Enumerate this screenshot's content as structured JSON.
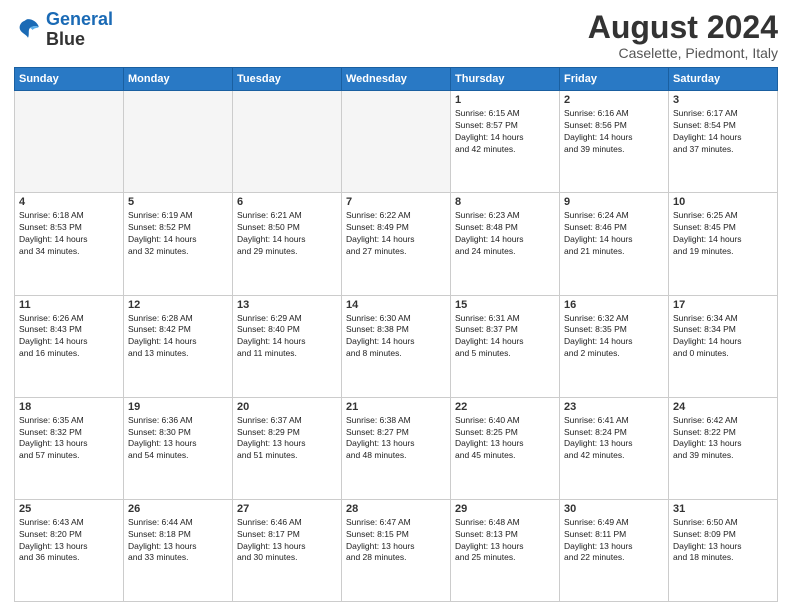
{
  "header": {
    "logo_line1": "General",
    "logo_line2": "Blue",
    "month_year": "August 2024",
    "location": "Caselette, Piedmont, Italy"
  },
  "weekdays": [
    "Sunday",
    "Monday",
    "Tuesday",
    "Wednesday",
    "Thursday",
    "Friday",
    "Saturday"
  ],
  "weeks": [
    [
      {
        "day": "",
        "info": ""
      },
      {
        "day": "",
        "info": ""
      },
      {
        "day": "",
        "info": ""
      },
      {
        "day": "",
        "info": ""
      },
      {
        "day": "1",
        "info": "Sunrise: 6:15 AM\nSunset: 8:57 PM\nDaylight: 14 hours\nand 42 minutes."
      },
      {
        "day": "2",
        "info": "Sunrise: 6:16 AM\nSunset: 8:56 PM\nDaylight: 14 hours\nand 39 minutes."
      },
      {
        "day": "3",
        "info": "Sunrise: 6:17 AM\nSunset: 8:54 PM\nDaylight: 14 hours\nand 37 minutes."
      }
    ],
    [
      {
        "day": "4",
        "info": "Sunrise: 6:18 AM\nSunset: 8:53 PM\nDaylight: 14 hours\nand 34 minutes."
      },
      {
        "day": "5",
        "info": "Sunrise: 6:19 AM\nSunset: 8:52 PM\nDaylight: 14 hours\nand 32 minutes."
      },
      {
        "day": "6",
        "info": "Sunrise: 6:21 AM\nSunset: 8:50 PM\nDaylight: 14 hours\nand 29 minutes."
      },
      {
        "day": "7",
        "info": "Sunrise: 6:22 AM\nSunset: 8:49 PM\nDaylight: 14 hours\nand 27 minutes."
      },
      {
        "day": "8",
        "info": "Sunrise: 6:23 AM\nSunset: 8:48 PM\nDaylight: 14 hours\nand 24 minutes."
      },
      {
        "day": "9",
        "info": "Sunrise: 6:24 AM\nSunset: 8:46 PM\nDaylight: 14 hours\nand 21 minutes."
      },
      {
        "day": "10",
        "info": "Sunrise: 6:25 AM\nSunset: 8:45 PM\nDaylight: 14 hours\nand 19 minutes."
      }
    ],
    [
      {
        "day": "11",
        "info": "Sunrise: 6:26 AM\nSunset: 8:43 PM\nDaylight: 14 hours\nand 16 minutes."
      },
      {
        "day": "12",
        "info": "Sunrise: 6:28 AM\nSunset: 8:42 PM\nDaylight: 14 hours\nand 13 minutes."
      },
      {
        "day": "13",
        "info": "Sunrise: 6:29 AM\nSunset: 8:40 PM\nDaylight: 14 hours\nand 11 minutes."
      },
      {
        "day": "14",
        "info": "Sunrise: 6:30 AM\nSunset: 8:38 PM\nDaylight: 14 hours\nand 8 minutes."
      },
      {
        "day": "15",
        "info": "Sunrise: 6:31 AM\nSunset: 8:37 PM\nDaylight: 14 hours\nand 5 minutes."
      },
      {
        "day": "16",
        "info": "Sunrise: 6:32 AM\nSunset: 8:35 PM\nDaylight: 14 hours\nand 2 minutes."
      },
      {
        "day": "17",
        "info": "Sunrise: 6:34 AM\nSunset: 8:34 PM\nDaylight: 14 hours\nand 0 minutes."
      }
    ],
    [
      {
        "day": "18",
        "info": "Sunrise: 6:35 AM\nSunset: 8:32 PM\nDaylight: 13 hours\nand 57 minutes."
      },
      {
        "day": "19",
        "info": "Sunrise: 6:36 AM\nSunset: 8:30 PM\nDaylight: 13 hours\nand 54 minutes."
      },
      {
        "day": "20",
        "info": "Sunrise: 6:37 AM\nSunset: 8:29 PM\nDaylight: 13 hours\nand 51 minutes."
      },
      {
        "day": "21",
        "info": "Sunrise: 6:38 AM\nSunset: 8:27 PM\nDaylight: 13 hours\nand 48 minutes."
      },
      {
        "day": "22",
        "info": "Sunrise: 6:40 AM\nSunset: 8:25 PM\nDaylight: 13 hours\nand 45 minutes."
      },
      {
        "day": "23",
        "info": "Sunrise: 6:41 AM\nSunset: 8:24 PM\nDaylight: 13 hours\nand 42 minutes."
      },
      {
        "day": "24",
        "info": "Sunrise: 6:42 AM\nSunset: 8:22 PM\nDaylight: 13 hours\nand 39 minutes."
      }
    ],
    [
      {
        "day": "25",
        "info": "Sunrise: 6:43 AM\nSunset: 8:20 PM\nDaylight: 13 hours\nand 36 minutes."
      },
      {
        "day": "26",
        "info": "Sunrise: 6:44 AM\nSunset: 8:18 PM\nDaylight: 13 hours\nand 33 minutes."
      },
      {
        "day": "27",
        "info": "Sunrise: 6:46 AM\nSunset: 8:17 PM\nDaylight: 13 hours\nand 30 minutes."
      },
      {
        "day": "28",
        "info": "Sunrise: 6:47 AM\nSunset: 8:15 PM\nDaylight: 13 hours\nand 28 minutes."
      },
      {
        "day": "29",
        "info": "Sunrise: 6:48 AM\nSunset: 8:13 PM\nDaylight: 13 hours\nand 25 minutes."
      },
      {
        "day": "30",
        "info": "Sunrise: 6:49 AM\nSunset: 8:11 PM\nDaylight: 13 hours\nand 22 minutes."
      },
      {
        "day": "31",
        "info": "Sunrise: 6:50 AM\nSunset: 8:09 PM\nDaylight: 13 hours\nand 18 minutes."
      }
    ]
  ]
}
